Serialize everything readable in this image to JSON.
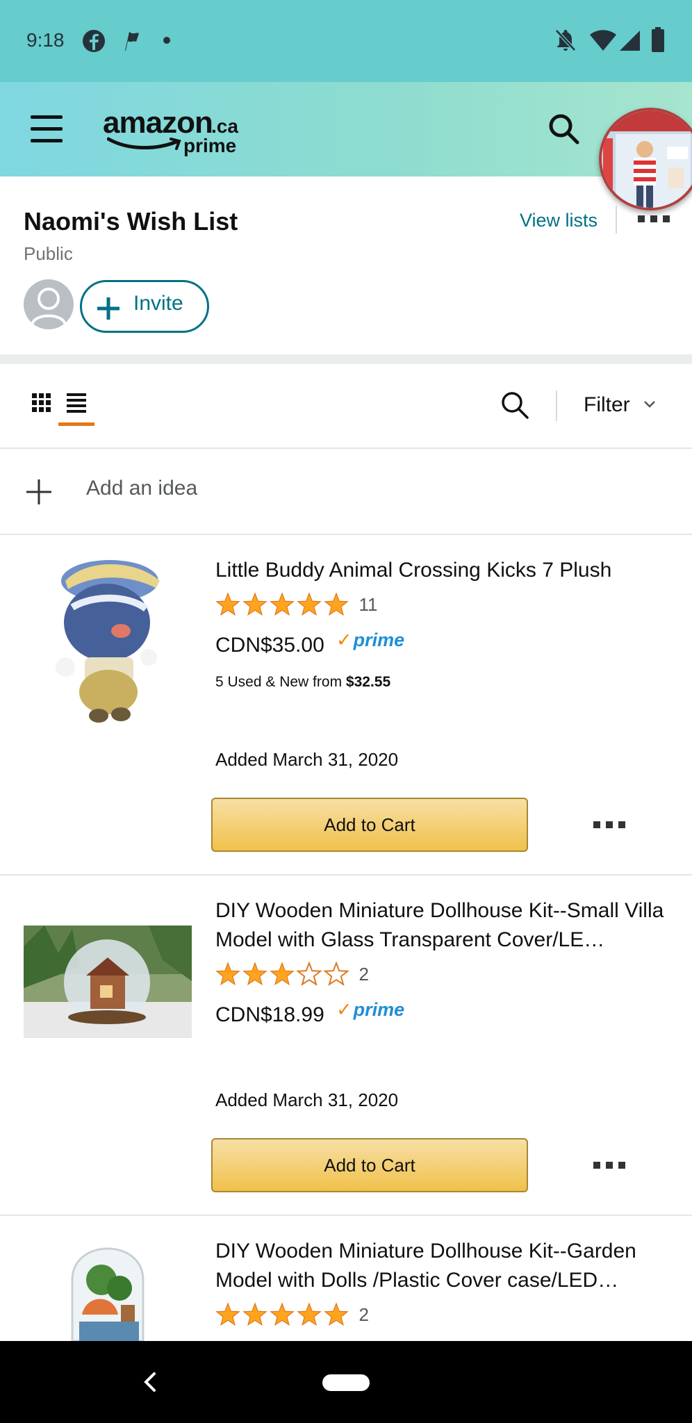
{
  "status_bar": {
    "time": "9:18"
  },
  "header": {
    "logo_text": "amazon",
    "logo_suffix": ".ca",
    "logo_sub": "prime"
  },
  "wishlist": {
    "title": "Naomi's Wish List",
    "privacy": "Public",
    "view_lists_label": "View lists",
    "invite_label": "Invite"
  },
  "toolbar": {
    "filter_label": "Filter"
  },
  "add_idea_label": "Add an idea",
  "items": [
    {
      "title": "Little Buddy Animal Crossing Kicks 7 Plush",
      "rating": 5,
      "rating_count": "11",
      "price": "CDN$35.00",
      "prime": "prime",
      "used_new_text": "5 Used & New  from ",
      "used_new_price": "$32.55",
      "added": "Added March 31, 2020",
      "cart_label": "Add to Cart"
    },
    {
      "title": "DIY Wooden Miniature Dollhouse Kit--Small Villa Model with Glass Transparent Cover/LE…",
      "rating": 3,
      "rating_count": "2",
      "price": "CDN$18.99",
      "prime": "prime",
      "added": "Added March 31, 2020",
      "cart_label": "Add to Cart"
    },
    {
      "title": "DIY Wooden Miniature Dollhouse Kit--Garden Model with Dolls /Plastic Cover case/LED…",
      "rating": 5,
      "rating_count": "2"
    }
  ],
  "colors": {
    "status_bar": "#66cccc",
    "link": "#007185",
    "star": "#ffa41c",
    "cart_button": "#f0c14b",
    "view_underline": "#e47911",
    "prime_blue": "#1f8ed6"
  }
}
